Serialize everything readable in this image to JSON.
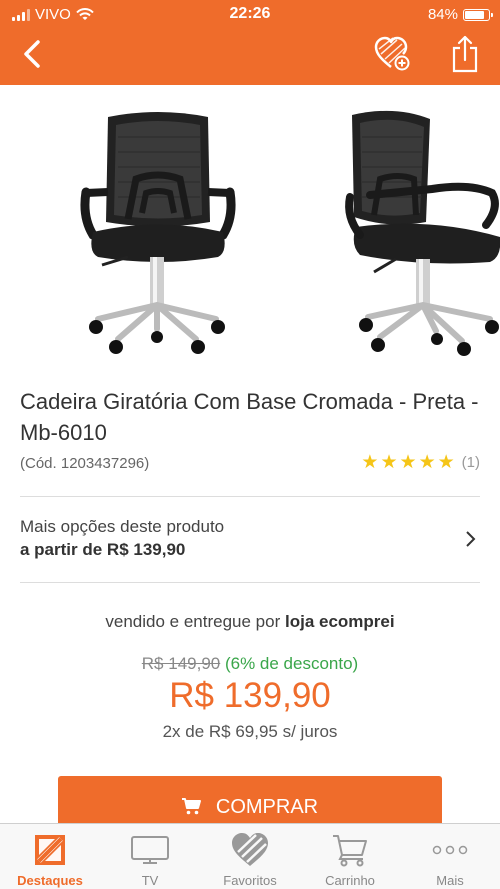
{
  "status_bar": {
    "carrier": "VIVO",
    "time": "22:26",
    "battery": "84%",
    "battery_level": 0.84
  },
  "header": {
    "back_icon": "chevron-left-icon",
    "favorite_icon": "heart-add-icon",
    "share_icon": "share-icon"
  },
  "product": {
    "title": "Cadeira Giratória Com Base Cromada - Preta - Mb-6010",
    "code": "(Cód. 1203437296)",
    "rating": 5,
    "rating_count": "(1)"
  },
  "options": {
    "line1": "Mais opções deste produto",
    "line2": "a partir de R$ 139,90"
  },
  "seller": {
    "prefix": "vendido e entregue por",
    "name": "loja ecomprei"
  },
  "pricing": {
    "old_price": "R$ 149,90",
    "discount": "(6% de desconto)",
    "price": "R$ 139,90",
    "installments": "2x de R$ 69,95 s/ juros"
  },
  "buy_button": {
    "label": "COMPRAR",
    "icon": "cart-icon"
  },
  "tabbar": [
    {
      "label": "Destaques",
      "icon": "highlights-icon",
      "active": true
    },
    {
      "label": "TV",
      "icon": "tv-icon",
      "active": false
    },
    {
      "label": "Favoritos",
      "icon": "heart-icon",
      "active": false
    },
    {
      "label": "Carrinho",
      "icon": "cart-icon",
      "active": false
    },
    {
      "label": "Mais",
      "icon": "more-icon",
      "active": false
    }
  ],
  "colors": {
    "accent": "#ef6c2b",
    "discount": "#3aa64a",
    "star": "#f5c518"
  }
}
